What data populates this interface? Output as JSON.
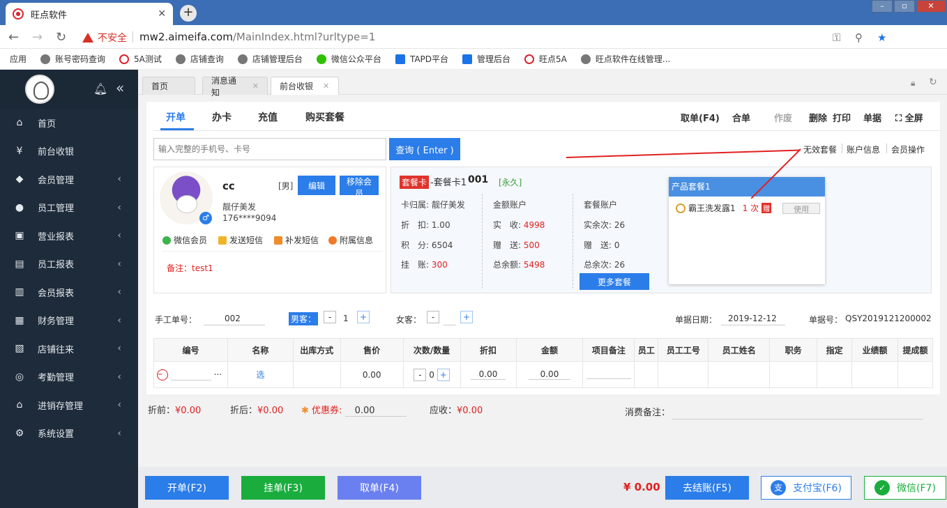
{
  "browser": {
    "tab_title": "旺点软件",
    "security_label": "不安全",
    "url_host": "mw2.aimeifa.com",
    "url_path": "/MainIndex.html?urltype=1",
    "bookmarks": [
      "应用",
      "账号密码查询",
      "5A测试",
      "店铺查询",
      "店铺管理后台",
      "微信公众平台",
      "TAPD平台",
      "管理后台",
      "旺点5A",
      "旺点软件在线管理..."
    ]
  },
  "sidebar": {
    "items": [
      {
        "label": "首页",
        "icon": "home-icon"
      },
      {
        "label": "前台收银",
        "icon": "yen-icon"
      },
      {
        "label": "会员管理",
        "icon": "diamond-icon"
      },
      {
        "label": "员工管理",
        "icon": "person-icon"
      },
      {
        "label": "营业报表",
        "icon": "monitor-icon"
      },
      {
        "label": "员工报表",
        "icon": "staff-report-icon"
      },
      {
        "label": "会员报表",
        "icon": "member-report-icon"
      },
      {
        "label": "财务管理",
        "icon": "finance-icon"
      },
      {
        "label": "店铺往来",
        "icon": "building-icon"
      },
      {
        "label": "考勤管理",
        "icon": "fingerprint-icon"
      },
      {
        "label": "进销存管理",
        "icon": "inventory-icon"
      },
      {
        "label": "系统设置",
        "icon": "gear-icon"
      }
    ]
  },
  "content_tabs": [
    "首页",
    "消息通知",
    "前台收银"
  ],
  "order_tabs": [
    "开单",
    "办卡",
    "充值",
    "购买套餐"
  ],
  "order_actions": [
    "取单(F4)",
    "合单",
    "作废",
    "删除",
    "打印",
    "单据",
    "全屏"
  ],
  "search": {
    "placeholder": "输入完整的手机号、卡号",
    "button": "查询 ( Enter )"
  },
  "member_links": [
    "无效套餐",
    "账户信息",
    "会员操作"
  ],
  "member": {
    "name": "cc",
    "gender": "[男]",
    "edit": "编辑",
    "remove": "移除会员",
    "shop": "靓仔美发",
    "phone": "176****9094",
    "actions": [
      "微信会员",
      "发送短信",
      "补发短信",
      "附属信息"
    ],
    "note": "备注：test1"
  },
  "card": {
    "tag": "套餐卡",
    "name": "-套餐卡1",
    "number": "001",
    "validity": "[永久]",
    "col1": [
      "卡归属: 靓仔美发",
      "折　扣: 1.00",
      "积　分: 6504",
      "挂　账: "
    ],
    "col1_debt": "300",
    "col2_title": "金额账户",
    "col2_labels": [
      "实　收: ",
      "赠　送: ",
      "总余额: "
    ],
    "col2_values": [
      "4998",
      "500",
      "5498"
    ],
    "col3_title": "套餐账户",
    "col3": [
      "实余次: 26",
      "赠　送: 0",
      "总余次: 26"
    ],
    "more": "更多套餐"
  },
  "package": {
    "title": "产品套餐1",
    "item": "霸王洗发露1",
    "count": "1 次",
    "gift": "赠",
    "use": "使用"
  },
  "form": {
    "manual_no_label": "手工单号：",
    "manual_no": "002",
    "male_label": "男客：",
    "male_count": "1",
    "female_label": "女客：",
    "date_label": "单据日期：",
    "date": "2019-12-12",
    "bill_label": "单据号：",
    "bill_no": "QSY2019121200002"
  },
  "table": {
    "headers": [
      "编号",
      "名称",
      "出库方式",
      "售价",
      "次数/数量",
      "折扣",
      "金额",
      "项目备注",
      "员工",
      "员工工号",
      "员工姓名",
      "职务",
      "指定",
      "业绩额",
      "提成额"
    ],
    "row": {
      "pick": "选",
      "price": "0.00",
      "qty": "0",
      "discount": "0.00",
      "amount": "0.00",
      "more": "···"
    }
  },
  "totals": {
    "before_label": "折前：",
    "before": "¥0.00",
    "after_label": "折后：",
    "after": "¥0.00",
    "coupon_label": "优惠券:",
    "coupon": "0.00",
    "due_label": "应收：",
    "due": "¥0.00",
    "remark_label": "消费备注："
  },
  "bottom": {
    "open": "开单(F2)",
    "hold": "挂单(F3)",
    "take": "取单(F4)",
    "total": "¥ 0.00",
    "checkout": "去结账(F5)",
    "alipay": "支付宝(F6)",
    "wechat": "微信(F7)"
  },
  "colors": {
    "primary": "#2b7de9",
    "sidebar": "#1e2b3a",
    "danger": "#e02020",
    "green": "#1aad3e",
    "purple": "#6a80f0"
  }
}
